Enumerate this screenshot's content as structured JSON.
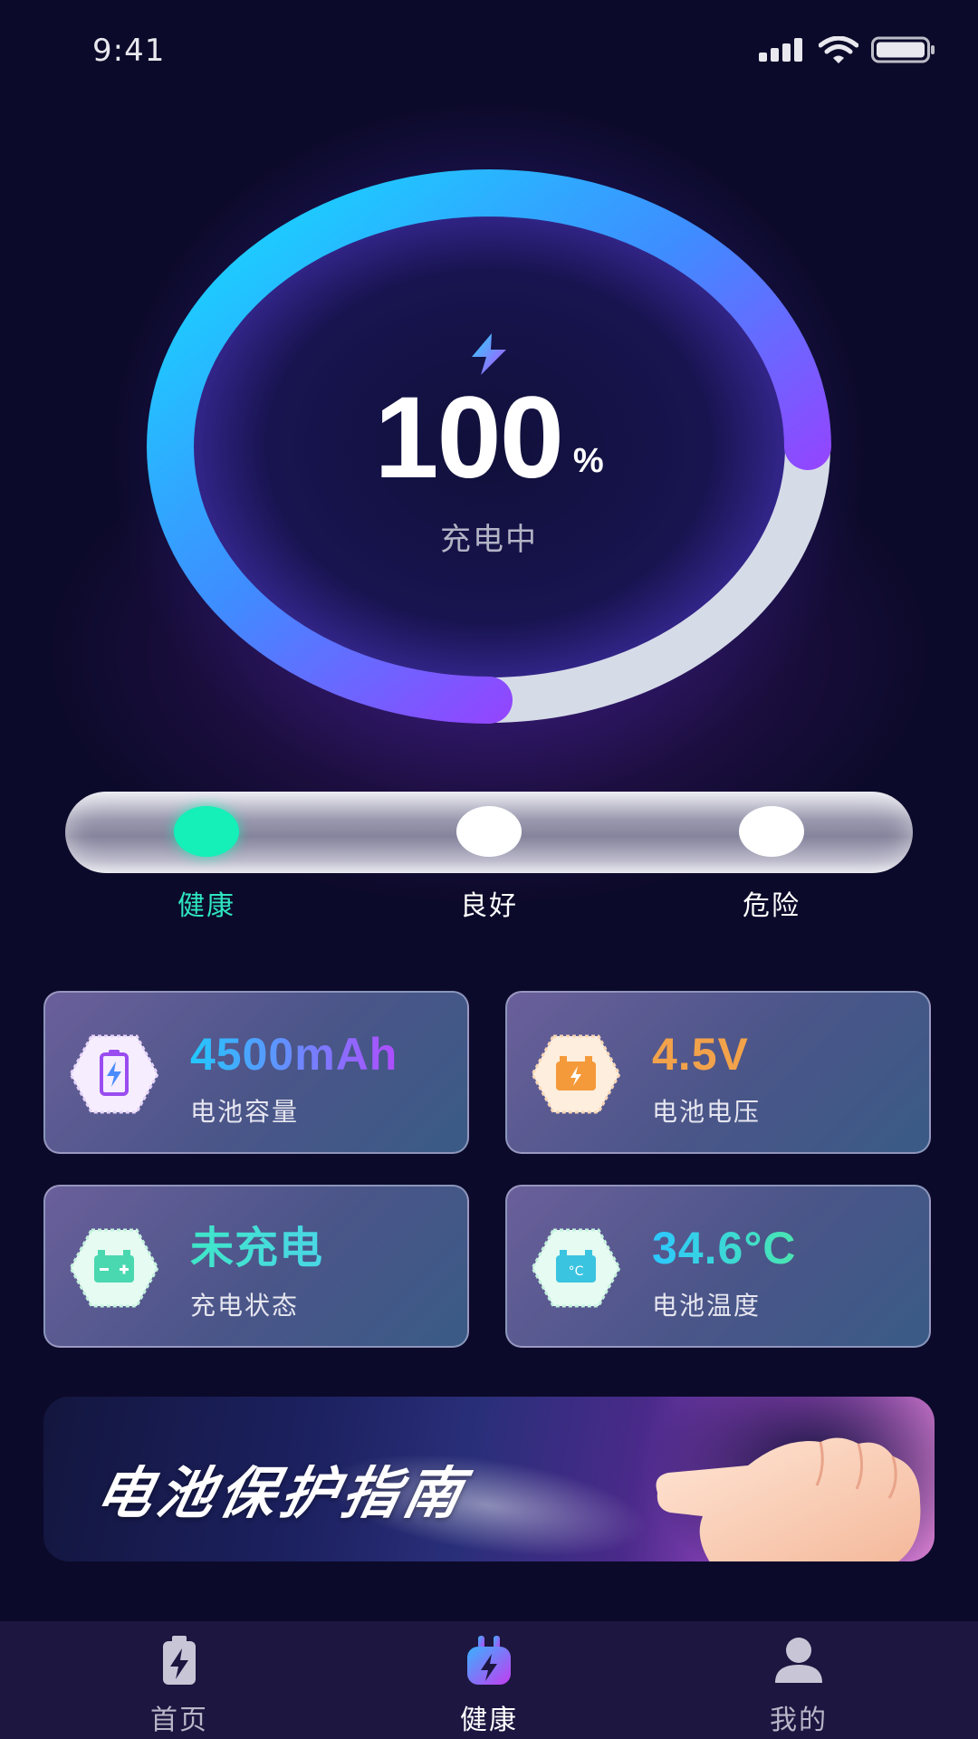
{
  "status_bar": {
    "time": "9:41"
  },
  "battery_gauge": {
    "percent": "100",
    "percent_unit": "%",
    "state": "充电中",
    "ring_fill_fraction": 0.75
  },
  "health": {
    "levels": [
      "健康",
      "良好",
      "危险"
    ],
    "selected": "健康"
  },
  "cards": [
    {
      "value": "4500mAh",
      "label": "电池容量",
      "icon": "battery-bolt-icon"
    },
    {
      "value": "4.5V",
      "label": "电池电压",
      "icon": "car-battery-icon"
    },
    {
      "value": "未充电",
      "label": "充电状态",
      "icon": "battery-plus-minus-icon"
    },
    {
      "value": "34.6°C",
      "label": "电池温度",
      "icon": "battery-temperature-icon"
    }
  ],
  "banner": {
    "title": "电池保护指南"
  },
  "tabbar": {
    "tabs": [
      {
        "label": "首页",
        "icon": "battery-bolt-tab-icon"
      },
      {
        "label": "健康",
        "icon": "charger-plug-tab-icon"
      },
      {
        "label": "我的",
        "icon": "user-tab-icon"
      }
    ],
    "active": "健康"
  },
  "colors": {
    "background": "#0c0a2a",
    "ring_start": "#12d6ff",
    "ring_end": "#c81cf0",
    "healthy": "#14f0b8",
    "voltage": "#f2a24a",
    "tabbar": "#1d1640"
  }
}
